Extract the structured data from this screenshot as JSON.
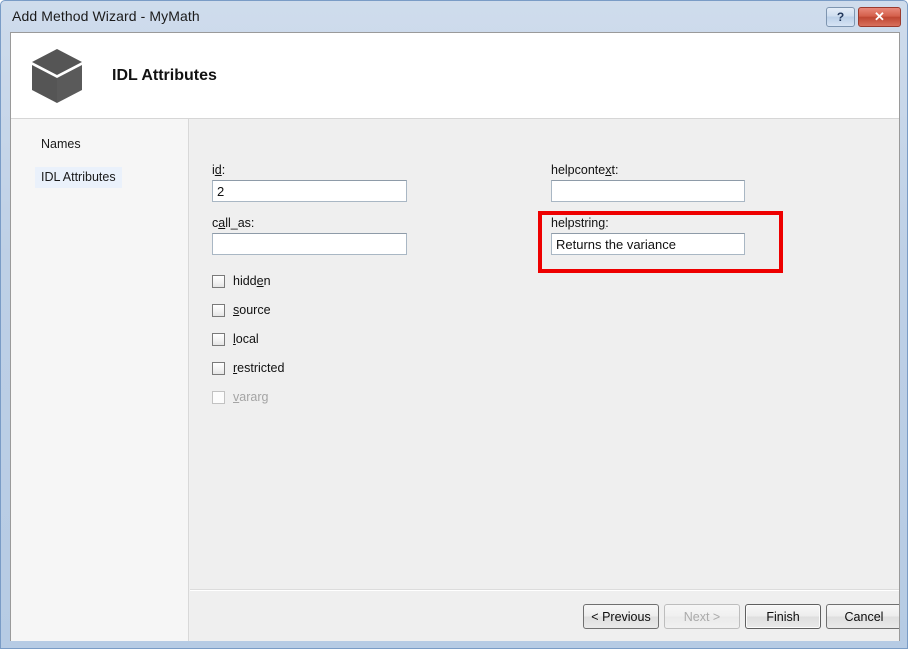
{
  "window": {
    "title": "Add Method Wizard - MyMath",
    "help_button": "?",
    "close_button": "✕",
    "help_icon_name": "help-icon",
    "close_icon_name": "close-icon"
  },
  "header": {
    "title": "IDL Attributes",
    "icon": "box-cube-icon"
  },
  "sidebar": {
    "items": [
      {
        "label": "Names",
        "selected": false
      },
      {
        "label": "IDL Attributes",
        "selected": true
      }
    ]
  },
  "main": {
    "fields": [
      {
        "name": "id",
        "label_before": "i",
        "label_accel": "d",
        "label_after": ":",
        "value": "2",
        "placeholder": ""
      },
      {
        "name": "call_as",
        "label_before": "c",
        "label_accel": "a",
        "label_after": "ll_as:",
        "value": "",
        "placeholder": ""
      },
      {
        "name": "helpcontext",
        "label_before": "helpconte",
        "label_accel": "x",
        "label_after": "t:",
        "value": "",
        "placeholder": ""
      },
      {
        "name": "helpstring",
        "label_before": "helpstrin",
        "label_accel": "g",
        "label_after": ":",
        "value": "Returns the variance",
        "placeholder": ""
      }
    ],
    "checkboxes": [
      {
        "name": "hidden",
        "before": "hidd",
        "accel": "e",
        "after": "n",
        "checked": false,
        "disabled": false
      },
      {
        "name": "source",
        "before": "",
        "accel": "s",
        "after": "ource",
        "checked": false,
        "disabled": false
      },
      {
        "name": "local",
        "before": "",
        "accel": "l",
        "after": "ocal",
        "checked": false,
        "disabled": false
      },
      {
        "name": "restricted",
        "before": "",
        "accel": "r",
        "after": "estricted",
        "checked": false,
        "disabled": false
      },
      {
        "name": "vararg",
        "before": "",
        "accel": "v",
        "after": "ararg",
        "checked": false,
        "disabled": true
      }
    ],
    "annotation_color": "#ee0000"
  },
  "buttons": {
    "previous": {
      "label": "< Previous",
      "disabled": false,
      "default": false
    },
    "next": {
      "label": "Next >",
      "disabled": true,
      "default": false
    },
    "finish": {
      "label": "Finish",
      "disabled": false,
      "default": true
    },
    "cancel": {
      "label": "Cancel",
      "disabled": false,
      "default": false
    }
  }
}
